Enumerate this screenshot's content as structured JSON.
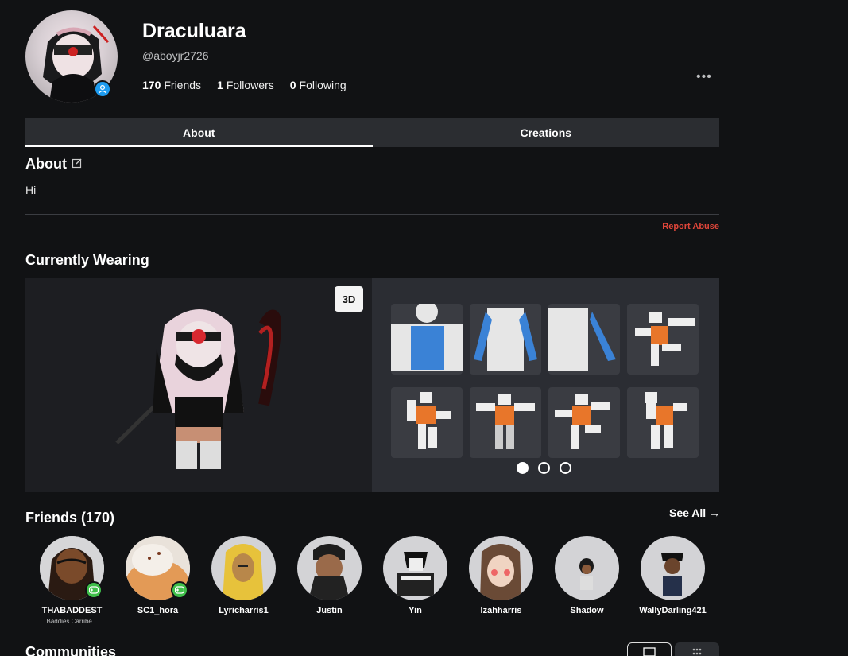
{
  "profile": {
    "display_name": "Draculuara",
    "username": "@aboyjr2726",
    "friends_count": "170",
    "friends_label": "Friends",
    "followers_count": "1",
    "followers_label": "Followers",
    "following_count": "0",
    "following_label": "Following",
    "more_label": "•••"
  },
  "tabs": [
    {
      "label": "About",
      "active": true
    },
    {
      "label": "Creations",
      "active": false
    }
  ],
  "about": {
    "title": "About",
    "text": "Hi",
    "report_label": "Report Abuse"
  },
  "wearing": {
    "title": "Currently Wearing",
    "toggle_3d_label": "3D",
    "page_dots": 3,
    "active_dot": 0
  },
  "friends": {
    "title": "Friends (170)",
    "see_all_label": "See All →",
    "items": [
      {
        "name": "THABADDEST",
        "sub": "Baddies Carribe...",
        "in_game": true
      },
      {
        "name": "SC1_hora",
        "sub": "",
        "in_game": true
      },
      {
        "name": "Lyricharris1",
        "sub": "",
        "in_game": false
      },
      {
        "name": "Justin",
        "sub": "",
        "in_game": false
      },
      {
        "name": "Yin",
        "sub": "",
        "in_game": false
      },
      {
        "name": "Izahharris",
        "sub": "",
        "in_game": false
      },
      {
        "name": "Shadow",
        "sub": "",
        "in_game": false
      },
      {
        "name": "WallyDarling421",
        "sub": "",
        "in_game": false
      }
    ]
  },
  "communities": {
    "title": "Communities"
  },
  "colors": {
    "background": "#111214",
    "tab_bar": "#2b2d31",
    "report": "#e0463a",
    "verified": "#1e9cf0",
    "in_game_badge": "#3fbf4a"
  }
}
